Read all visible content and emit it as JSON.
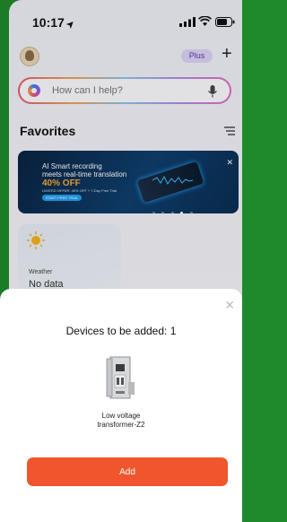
{
  "status_bar": {
    "time": "10:17"
  },
  "header": {
    "plus_badge": "Plus",
    "add_icon": "plus-icon"
  },
  "search": {
    "placeholder": "How can I help?"
  },
  "favorites": {
    "title": "Favorites"
  },
  "banner": {
    "line1": "AI Smart recording",
    "line2": "meets real-time translation",
    "discount": "40% OFF",
    "fine_print": "LIMITED OFFER: 40% OFF + 7-Day Free Trial",
    "cta": "START FREE TRIAL",
    "slide_count": 5,
    "active_slide": 4
  },
  "weather_card": {
    "label": "Weather",
    "value": "No data"
  },
  "sheet": {
    "title": "Devices to be added: 1",
    "device_name_line1": "Low voltage",
    "device_name_line2": "transformer-Z2",
    "add_label": "Add",
    "accent_color": "#f0552d"
  }
}
